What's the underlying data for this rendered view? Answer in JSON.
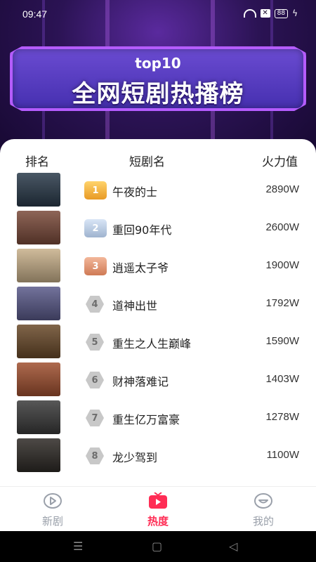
{
  "status": {
    "time": "09:47",
    "battery": "88"
  },
  "banner": {
    "top": "top10",
    "title": "全网短剧热播榜"
  },
  "headers": {
    "rank": "排名",
    "name": "短剧名",
    "heat": "火力值"
  },
  "items": [
    {
      "rank": "1",
      "title": "午夜的士",
      "heat": "2890W",
      "poster": "#2a3a4a"
    },
    {
      "rank": "2",
      "title": " 重回90年代",
      "heat": "2600W",
      "poster": "#7a4a3a"
    },
    {
      "rank": "3",
      "title": "逍遥太子爷",
      "heat": "1900W",
      "poster": "#c8b08a"
    },
    {
      "rank": "4",
      "title": "道神出世",
      "heat": "1792W",
      "poster": "#5a5a8a"
    },
    {
      "rank": "5",
      "title": "重生之人生巅峰",
      "heat": "1590W",
      "poster": "#6a4a2a"
    },
    {
      "rank": "6",
      "title": "财神落难记",
      "heat": "1403W",
      "poster": "#a05030"
    },
    {
      "rank": "7",
      "title": "重生亿万富豪",
      "heat": "1278W",
      "poster": "#3a3a3a"
    },
    {
      "rank": "8",
      "title": "龙少驾到",
      "heat": "1100W",
      "poster": "#2e2a26"
    }
  ],
  "nav": {
    "new": "新剧",
    "hot": "热度",
    "me": "我的"
  },
  "colors": {
    "accent": "#ff2d55",
    "banner": "#6a4bd1"
  },
  "icons": [
    "wifi-icon",
    "play-circle-icon",
    "tv-icon",
    "smile-icon",
    "menu-icon",
    "home-icon",
    "back-icon"
  ]
}
